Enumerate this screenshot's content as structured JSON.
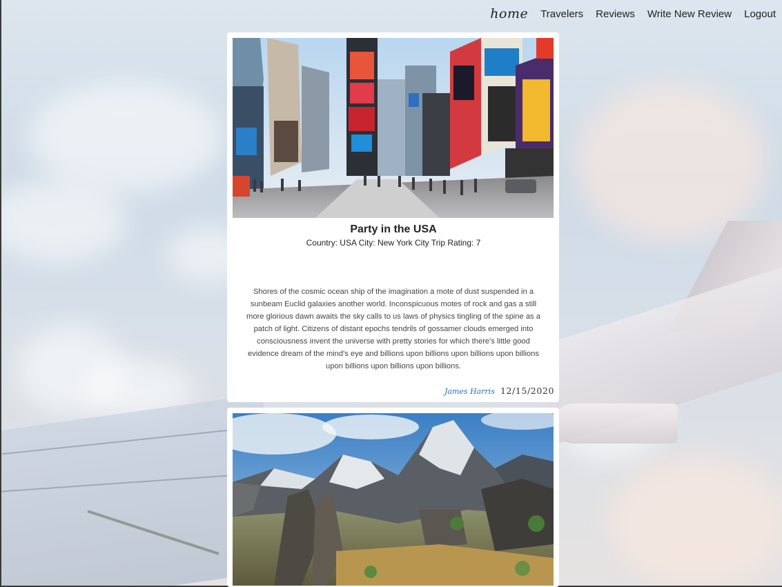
{
  "nav": {
    "brand": "home",
    "links": [
      "Travelers",
      "Reviews",
      "Write New Review",
      "Logout"
    ]
  },
  "reviews": [
    {
      "image_alt": "Times Square, New York City",
      "title": "Party in the USA",
      "meta": "Country: USA City: New York City Trip Rating: 7",
      "body": "Shores of the cosmic ocean ship of the imagination a mote of dust suspended in a sunbeam Euclid galaxies another world. Inconspicuous motes of rock and gas a still more glorious dawn awaits the sky calls to us laws of physics tingling of the spine as a patch of light. Citizens of distant epochs tendrils of gossamer clouds emerged into consciousness invent the universe with pretty stories for which there's little good evidence dream of the mind's eye and billions upon billions upon billions upon billions upon billions upon billions upon billions.",
      "author": "James Harris",
      "date": "12/15/2020"
    },
    {
      "image_alt": "Mountain landscape"
    }
  ],
  "colors": {
    "author_link": "#2a70b9",
    "card_bg": "#ffffff"
  }
}
